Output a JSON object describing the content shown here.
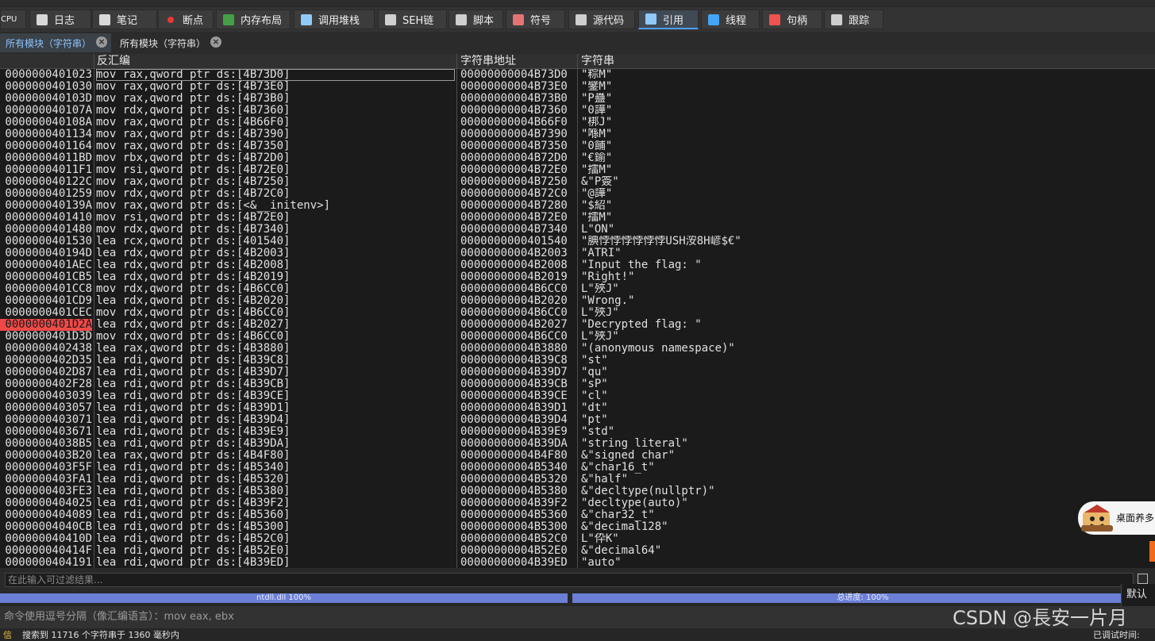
{
  "tabs": [
    {
      "label": "CPU",
      "icon": "cpu-icon"
    },
    {
      "label": "日志",
      "icon": "log-icon"
    },
    {
      "label": "笔记",
      "icon": "notes-icon"
    },
    {
      "label": "断点",
      "icon": "breakpoint-icon"
    },
    {
      "label": "内存布局",
      "icon": "memory-map-icon"
    },
    {
      "label": "调用堆栈",
      "icon": "call-stack-icon"
    },
    {
      "label": "SEH链",
      "icon": "seh-chain-icon"
    },
    {
      "label": "脚本",
      "icon": "script-icon"
    },
    {
      "label": "符号",
      "icon": "symbols-icon"
    },
    {
      "label": "源代码",
      "icon": "source-icon"
    },
    {
      "label": "引用",
      "icon": "references-icon"
    },
    {
      "label": "线程",
      "icon": "threads-icon"
    },
    {
      "label": "句柄",
      "icon": "handles-icon"
    },
    {
      "label": "跟踪",
      "icon": "trace-icon"
    }
  ],
  "subtabs": [
    {
      "label": "所有模块（字符串）"
    },
    {
      "label": "所有模块（字符串）"
    }
  ],
  "columns": {
    "address": "",
    "disassembly": "反汇编",
    "string_address": "字符串地址",
    "string": "字符串"
  },
  "rows": [
    [
      "0000000401023",
      "mov rax,qword ptr ds:[4B73D0]",
      "00000000004B73D0",
      "\"粽M\""
    ],
    [
      "0000000401030",
      "mov rax,qword ptr ds:[4B73E0]",
      "00000000004B73E0",
      "\"鐾M\""
    ],
    [
      "000000040103D",
      "mov rax,qword ptr ds:[4B73B0]",
      "00000000004B73B0",
      "\"P蠱\""
    ],
    [
      "000000040107A",
      "mov rdx,qword ptr ds:[4B7360]",
      "00000000004B7360",
      "\"0譁\""
    ],
    [
      "000000040108A",
      "mov rax,qword ptr ds:[4B66F0]",
      "00000000004B66F0",
      "\"梆J\""
    ],
    [
      "0000000401134",
      "mov rax,qword ptr ds:[4B7390]",
      "00000000004B7390",
      "\"喺M\""
    ],
    [
      "0000000401164",
      "mov rax,qword ptr ds:[4B7350]",
      "00000000004B7350",
      "\"0餔\""
    ],
    [
      "00000004011BD",
      "mov rbx,qword ptr ds:[4B72D0]",
      "00000000004B72D0",
      "\"€鍮\""
    ],
    [
      "00000004011F1",
      "mov rsi,qword ptr ds:[4B72E0]",
      "00000000004B72E0",
      "\"擂M\""
    ],
    [
      "000000040122C",
      "mov rax,qword ptr ds:[4B7250]",
      "00000000004B7250",
      "&\"P簽\""
    ],
    [
      "0000000401259",
      "mov rdx,qword ptr ds:[4B72C0]",
      "00000000004B72C0",
      "\"@譁\""
    ],
    [
      "000000040139A",
      "mov rax,qword ptr ds:[<&__initenv>]",
      "00000000004B7280",
      "\"$紹\""
    ],
    [
      "0000000401410",
      "mov rsi,qword ptr ds:[4B72E0]",
      "00000000004B72E0",
      "\"擂M\""
    ],
    [
      "0000000401480",
      "mov rdx,qword ptr ds:[4B7340]",
      "00000000004B7340",
      "L\"ON\""
    ],
    [
      "0000000401530",
      "lea rcx,qword ptr ds:[401540]",
      "0000000000401540",
      "\"腆悖悖悖悖悖悖USH洝8H嵃$€\""
    ],
    [
      "000000040194D",
      "lea rdx,qword ptr ds:[4B2003]",
      "00000000004B2003",
      "\"ATRI\""
    ],
    [
      "0000000401AEC",
      "lea rdx,qword ptr ds:[4B2008]",
      "00000000004B2008",
      "\"Input the flag: \""
    ],
    [
      "0000000401CB5",
      "lea rdx,qword ptr ds:[4B2019]",
      "00000000004B2019",
      "\"Right!\""
    ],
    [
      "0000000401CC8",
      "mov rdx,qword ptr ds:[4B6CC0]",
      "00000000004B6CC0",
      "L\"殎J\""
    ],
    [
      "0000000401CD9",
      "lea rdx,qword ptr ds:[4B2020]",
      "00000000004B2020",
      "\"Wrong.\""
    ],
    [
      "0000000401CEC",
      "mov rdx,qword ptr ds:[4B6CC0]",
      "00000000004B6CC0",
      "L\"殎J\""
    ],
    [
      "0000000401D2A",
      "lea rdx,qword ptr ds:[4B2027]",
      "00000000004B2027",
      "\"Decrypted flag: \""
    ],
    [
      "0000000401D3D",
      "mov rdx,qword ptr ds:[4B6CC0]",
      "00000000004B6CC0",
      "L\"殎J\""
    ],
    [
      "0000000402438",
      "lea rax,qword ptr ds:[4B3880]",
      "00000000004B3880",
      "\"(anonymous namespace)\""
    ],
    [
      "0000000402D35",
      "lea rdi,qword ptr ds:[4B39C8]",
      "00000000004B39C8",
      "\"st\""
    ],
    [
      "0000000402D87",
      "lea rdi,qword ptr ds:[4B39D7]",
      "00000000004B39D7",
      "\"qu\""
    ],
    [
      "0000000402F28",
      "lea rdi,qword ptr ds:[4B39CB]",
      "00000000004B39CB",
      "\"sP\""
    ],
    [
      "0000000403039",
      "lea rdi,qword ptr ds:[4B39CE]",
      "00000000004B39CE",
      "\"cl\""
    ],
    [
      "0000000403057",
      "lea rdi,qword ptr ds:[4B39D1]",
      "00000000004B39D1",
      "\"dt\""
    ],
    [
      "0000000403071",
      "lea rdi,qword ptr ds:[4B39D4]",
      "00000000004B39D4",
      "\"pt\""
    ],
    [
      "0000000403671",
      "lea rdi,qword ptr ds:[4B39E9]",
      "00000000004B39E9",
      "\"std\""
    ],
    [
      "00000004038B5",
      "lea rdi,qword ptr ds:[4B39DA]",
      "00000000004B39DA",
      "\"string literal\""
    ],
    [
      "0000000403B20",
      "lea rax,qword ptr ds:[4B4F80]",
      "00000000004B4F80",
      "&\"signed char\""
    ],
    [
      "0000000403F5F",
      "lea rdi,qword ptr ds:[4B5340]",
      "00000000004B5340",
      "&\"char16_t\""
    ],
    [
      "0000000403FA1",
      "lea rdi,qword ptr ds:[4B5320]",
      "00000000004B5320",
      "&\"half\""
    ],
    [
      "0000000403FE3",
      "lea rdi,qword ptr ds:[4B5380]",
      "00000000004B5380",
      "&\"decltype(nullptr)\""
    ],
    [
      "0000000404025",
      "lea rdi,qword ptr ds:[4B39F2]",
      "00000000004B39F2",
      "\"decltype(auto)\""
    ],
    [
      "0000000404089",
      "lea rdi,qword ptr ds:[4B5360]",
      "00000000004B5360",
      "&\"char32_t\""
    ],
    [
      "00000004040CB",
      "lea rdi,qword ptr ds:[4B5300]",
      "00000000004B5300",
      "&\"decimal128\""
    ],
    [
      "000000040410D",
      "lea rdi,qword ptr ds:[4B52C0]",
      "00000000004B52C0",
      "L\"伜K\""
    ],
    [
      "000000040414F",
      "lea rdi,qword ptr ds:[4B52E0]",
      "00000000004B52E0",
      "&\"decimal64\""
    ],
    [
      "0000000404191",
      "lea rdi,qword ptr ds:[4B39ED]",
      "00000000004B39ED",
      "\"auto\""
    ]
  ],
  "selected_row_address": "0000000401D2A",
  "filter": {
    "placeholder": "在此输入可过滤结果..."
  },
  "progress": {
    "left": "ntdll.dll 100%",
    "right": "总进度: 100%",
    "left_value": 1.0,
    "right_value": 1.0
  },
  "command_bar": {
    "placeholder": "命令使用逗号分隔（像汇编语言）：mov eax, ebx"
  },
  "status": {
    "prefix": "信",
    "text": "搜索到 11716 个字符串于 1360 毫秒内",
    "right": "已调试时间:"
  },
  "finish_button": {
    "label": "默认"
  },
  "widget": {
    "label": "桌面养多"
  },
  "watermark": "CSDN @長安一片月",
  "colors": {
    "selected": "#f04848",
    "progress": "#6b7fd6",
    "active_tab": "#4ea1ff"
  }
}
